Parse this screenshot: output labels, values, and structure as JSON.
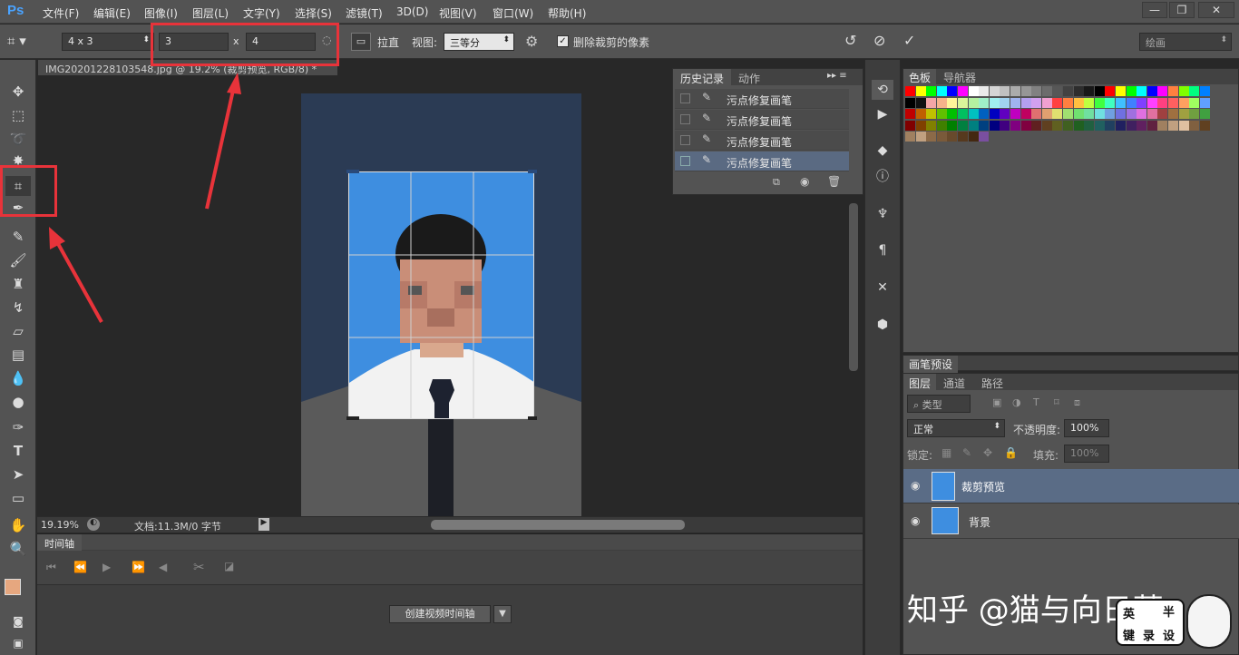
{
  "app": {
    "logo": "Ps"
  },
  "menu": [
    "文件(F)",
    "编辑(E)",
    "图像(I)",
    "图层(L)",
    "文字(Y)",
    "选择(S)",
    "滤镜(T)",
    "3D(D)",
    "视图(V)",
    "窗口(W)",
    "帮助(H)"
  ],
  "window_controls": [
    "—",
    "❐",
    "✕"
  ],
  "options": {
    "ratio_preset": "4 x 3",
    "width": "3",
    "times": "x",
    "height": "4",
    "straighten": "拉直",
    "view_label": "视图:",
    "view_value": "三等分",
    "delete_cropped": "删除裁剪的像素",
    "workspace": "绘画"
  },
  "document": {
    "tab_title": "IMG20201228103548.jpg @ 19.2% (裁剪预览, RGB/8) *",
    "zoom": "19.19%",
    "doc_info": "文档:11.3M/0 字节"
  },
  "history": {
    "tabs": [
      "历史记录",
      "动作"
    ],
    "items": [
      "污点修复画笔",
      "污点修复画笔",
      "污点修复画笔",
      "污点修复画笔"
    ]
  },
  "swatches": {
    "tabs": [
      "色板",
      "导航器"
    ],
    "rows": [
      [
        "#ff0000",
        "#ffff00",
        "#00ff00",
        "#00ffff",
        "#0000ff",
        "#ff00ff",
        "#ffffff",
        "#eaeaea",
        "#d5d5d5",
        "#c0c0c0",
        "#ababab",
        "#969696",
        "#818181",
        "#6c6c6c",
        "#575757",
        "#424242",
        "#2d2d2d",
        "#181818",
        "#000000",
        "#ff0000",
        "#ffff00",
        "#00ff00",
        "#00ffff",
        "#0000ff",
        "#ff00ff",
        "#ff8040",
        "#80ff00",
        "#00ff80",
        "#0080ff"
      ],
      [
        "#000000",
        "#111111",
        "#f4a6a6",
        "#f6b38a",
        "#fff59a",
        "#d9f59a",
        "#b4f0a0",
        "#a0f0c8",
        "#a0f0f0",
        "#a0d2f0",
        "#a0b4f0",
        "#b4a0f0",
        "#d2a0f0",
        "#f0a0d2",
        "#ff4040",
        "#ff8040",
        "#ffc040",
        "#c0ff40",
        "#40ff40",
        "#40ffc0",
        "#40c0ff",
        "#4080ff",
        "#8040ff",
        "#ff40ff",
        "#ff4080",
        "#ff6060",
        "#ffa060",
        "#a0ff60",
        "#60a0ff"
      ],
      [
        "#c00000",
        "#c06000",
        "#c0c000",
        "#60c000",
        "#00c000",
        "#00c060",
        "#00c0c0",
        "#0060c0",
        "#0000c0",
        "#6000c0",
        "#c000c0",
        "#c00060",
        "#e07070",
        "#e0a070",
        "#e0e070",
        "#a0e070",
        "#70e070",
        "#70e0a0",
        "#70e0e0",
        "#70a0e0",
        "#7070e0",
        "#a070e0",
        "#e070e0",
        "#e070a0",
        "#a04040",
        "#a07040",
        "#a0a040",
        "#70a040",
        "#40a040"
      ],
      [
        "#800000",
        "#804000",
        "#808000",
        "#408000",
        "#008000",
        "#008040",
        "#008080",
        "#004080",
        "#000080",
        "#400080",
        "#800080",
        "#800040",
        "#602020",
        "#604020",
        "#606020",
        "#406020",
        "#206020",
        "#206040",
        "#206060",
        "#204060",
        "#202060",
        "#402060",
        "#602060",
        "#602040",
        "#a08060",
        "#c0a080",
        "#e0c0a0",
        "#806040",
        "#604020"
      ],
      [
        "#a08060",
        "#c0a080",
        "#8c6a48",
        "#7a5a3a",
        "#684a2c",
        "#56391e",
        "#442810",
        "#7a4fa0"
      ]
    ]
  },
  "brush_panel": {
    "title": "画笔预设"
  },
  "layers": {
    "tabs": [
      "图层",
      "通道",
      "路径"
    ],
    "filter": "类型",
    "blend_mode": "正常",
    "opacity_label": "不透明度:",
    "opacity": "100%",
    "lock_label": "锁定:",
    "fill_label": "填充:",
    "fill": "100%",
    "items": [
      {
        "name": "裁剪预览",
        "selected": true
      },
      {
        "name": "背景",
        "selected": false
      }
    ]
  },
  "timeline": {
    "tab": "时间轴",
    "create_button": "创建视频时间轴"
  },
  "watermark": {
    "text": "知乎 @猫与向日葵",
    "stamp": [
      "英",
      "半",
      "键",
      "录",
      "设"
    ]
  }
}
